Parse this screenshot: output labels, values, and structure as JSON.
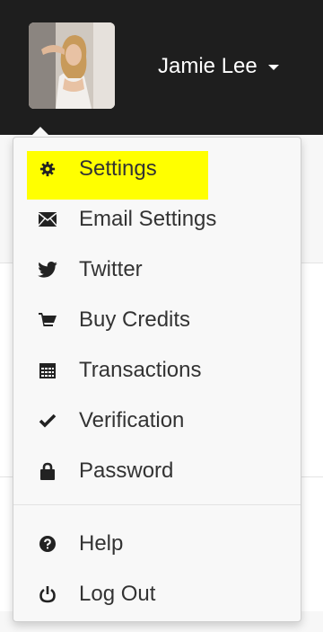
{
  "user": {
    "name": "Jamie Lee"
  },
  "menu": {
    "items": [
      {
        "label": "Settings",
        "icon": "gear-icon"
      },
      {
        "label": "Email Settings",
        "icon": "envelope-icon"
      },
      {
        "label": "Twitter",
        "icon": "twitter-bird-icon"
      },
      {
        "label": "Buy Credits",
        "icon": "shopping-cart-icon"
      },
      {
        "label": "Transactions",
        "icon": "calendar-icon"
      },
      {
        "label": "Verification",
        "icon": "check-icon"
      },
      {
        "label": "Password",
        "icon": "lock-icon"
      }
    ],
    "footer_items": [
      {
        "label": "Help",
        "icon": "question-circle-icon"
      },
      {
        "label": "Log Out",
        "icon": "power-icon"
      }
    ]
  },
  "colors": {
    "header_bg": "#1e1e1e",
    "highlight": "#ffff00",
    "text": "#333333"
  }
}
